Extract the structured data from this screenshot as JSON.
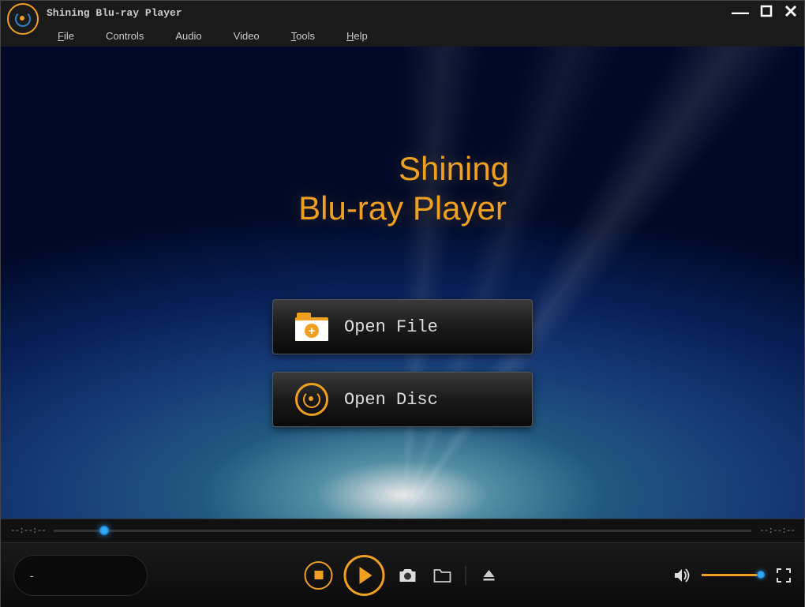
{
  "app": {
    "title": "Shining Blu-ray Player"
  },
  "menu": {
    "file": "File",
    "controls": "Controls",
    "audio": "Audio",
    "video": "Video",
    "tools": "Tools",
    "help": "Help"
  },
  "brand": {
    "line1": "Shining",
    "line2": "Blu-ray Player"
  },
  "actions": {
    "open_file": "Open File",
    "open_disc": "Open Disc"
  },
  "playback": {
    "current_time": "--:--:--",
    "total_time": "--:--:--",
    "info": "-"
  },
  "colors": {
    "accent": "#f0a020",
    "thumb_glow": "#33aaff"
  }
}
